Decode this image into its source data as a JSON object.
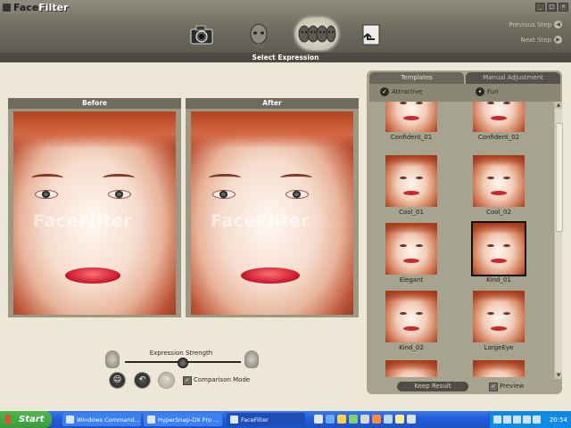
{
  "app": {
    "title_part1": "Face",
    "title_part2": "Filter"
  },
  "window_controls": [
    "_",
    "□",
    "×"
  ],
  "header": {
    "steps": [
      {
        "icon": "camera-icon"
      },
      {
        "icon": "head-icon"
      },
      {
        "icon": "expression-heads-icon",
        "active": true
      },
      {
        "icon": "save-return-icon"
      }
    ],
    "previous_step": "Previous Step",
    "next_step": "Next Step"
  },
  "section_title": "Select Expression",
  "before_panel": {
    "title": "Before",
    "watermark": "FaceFilter"
  },
  "after_panel": {
    "title": "After",
    "watermark": "FaceFilter"
  },
  "expression": {
    "strength_label": "Expression Strength",
    "strength_value": 0.5,
    "comparison_mode_label": "Comparison Mode",
    "comparison_mode_checked": true
  },
  "right_panel": {
    "tabs": [
      "Templates",
      "Manual Adjustment"
    ],
    "categories": [
      {
        "label": "Attractive",
        "checked": true
      },
      {
        "label": "Fun",
        "checked": false
      }
    ],
    "templates": [
      {
        "label": "Confident_01"
      },
      {
        "label": "Confident_02"
      },
      {
        "label": "Cool_01"
      },
      {
        "label": "Cool_02"
      },
      {
        "label": "Elegant"
      },
      {
        "label": "Kind_01",
        "selected": true
      },
      {
        "label": "Kind_02"
      },
      {
        "label": "LargeEye"
      },
      {
        "label": ""
      },
      {
        "label": ""
      }
    ],
    "keep_result": "Keep Result",
    "preview_label": "Preview",
    "preview_checked": true
  },
  "taskbar": {
    "start": "Start",
    "tasks": [
      {
        "label": "Windows Command..."
      },
      {
        "label": "HyperSnap-DX Pro ..."
      },
      {
        "label": "FaceFilter",
        "active": true
      }
    ],
    "clock": "20:54"
  }
}
